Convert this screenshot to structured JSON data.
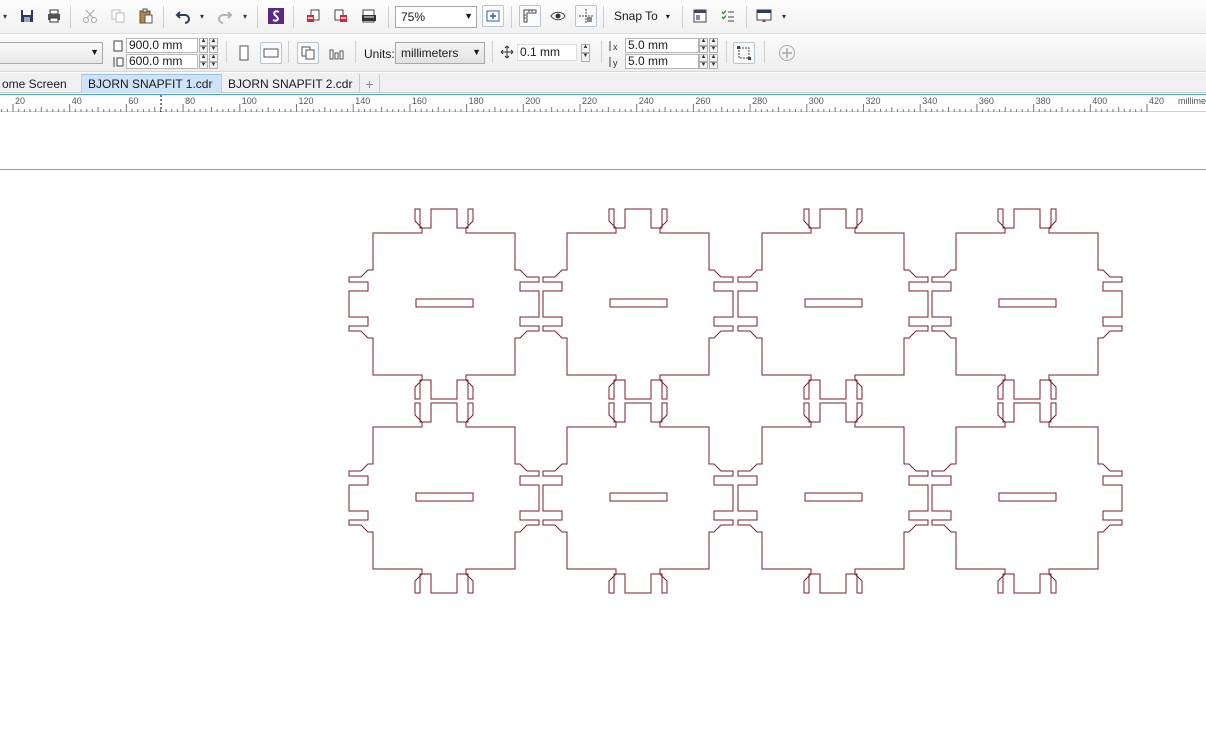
{
  "toolbar": {
    "zoom_value": "75%",
    "snap_to_label": "Snap To"
  },
  "property_bar": {
    "width_value": "900.0 mm",
    "height_value": "600.0 mm",
    "units_label": "Units:",
    "units_value": "millimeters",
    "nudge_value": "0.1 mm",
    "dup_x_value": "5.0 mm",
    "dup_y_value": "5.0 mm"
  },
  "tabs": [
    {
      "label": "ome Screen"
    },
    {
      "label": "BJORN SNAPFIT 1.cdr"
    },
    {
      "label": "BJORN SNAPFIT 2.cdr"
    }
  ],
  "ruler": {
    "labels": [
      "20",
      "40",
      "60",
      "80",
      "100",
      "120",
      "140",
      "160",
      "180",
      "200",
      "220",
      "240",
      "260",
      "280",
      "300",
      "320",
      "340",
      "360",
      "380",
      "400",
      "420"
    ],
    "unit": "millime"
  },
  "colors": {
    "outline": "#7a1f2b",
    "accent": "#4aa3df"
  }
}
